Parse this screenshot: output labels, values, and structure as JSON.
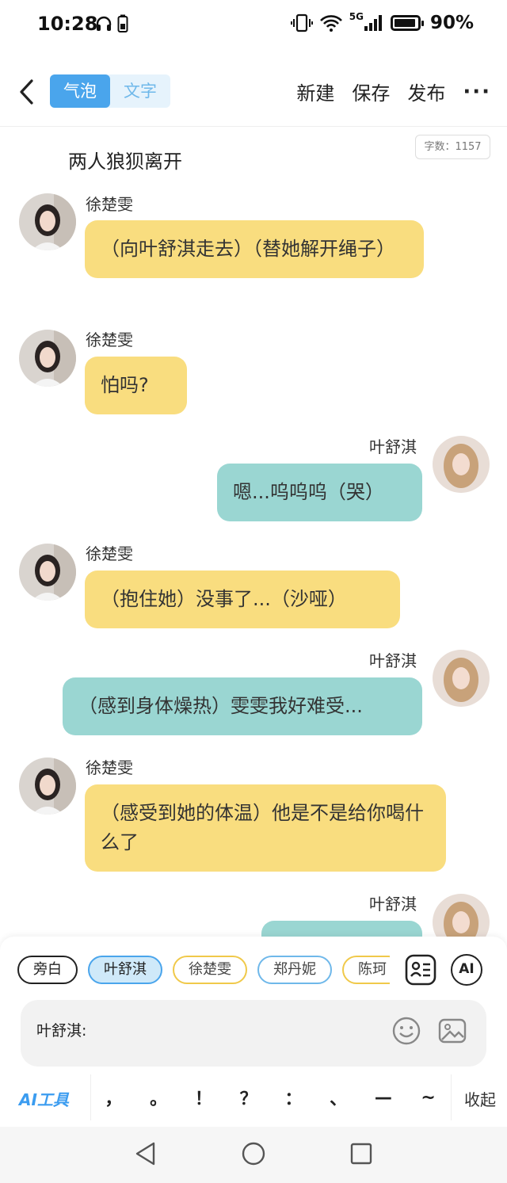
{
  "status_bar": {
    "time": "10:28",
    "network": "5G",
    "battery": "90%"
  },
  "toolbar": {
    "mode_tabs": [
      "气泡",
      "文字"
    ],
    "active_tab": "气泡",
    "new_label": "新建",
    "save_label": "保存",
    "publish_label": "发布",
    "more_label": "···"
  },
  "word_count": "字数：1157",
  "narration": "两人狼狈离开",
  "messages": [
    {
      "speaker": "徐楚雯",
      "side": "left",
      "text": "（向叶舒淇走去）（替她解开绳子）"
    },
    {
      "speaker": "徐楚雯",
      "side": "left",
      "text": "怕吗?"
    },
    {
      "speaker": "叶舒淇",
      "side": "right",
      "text": "嗯...呜呜呜（哭）"
    },
    {
      "speaker": "徐楚雯",
      "side": "left",
      "text": "（抱住她）没事了...（沙哑）"
    },
    {
      "speaker": "叶舒淇",
      "side": "right",
      "text": "（感到身体燥热）雯雯我好难受..."
    },
    {
      "speaker": "徐楚雯",
      "side": "left",
      "text": "（感受到她的体温）他是不是给你喝什么了"
    },
    {
      "speaker": "叶舒淇",
      "side": "right",
      "text": ""
    }
  ],
  "composer": {
    "roles": [
      "旁白",
      "叶舒淇",
      "徐楚雯",
      "郑丹妮",
      "陈珂"
    ],
    "selected_role": "叶舒淇",
    "input_prefix": "叶舒淇:",
    "ai_tool_label": "AI工具",
    "punctuation": [
      "，",
      "。",
      "！",
      "？",
      "：",
      "、",
      "—",
      "~"
    ],
    "collapse_label": "收起",
    "ai_button_label": "AI"
  },
  "colors": {
    "accent": "#4aa5ec",
    "left_bubble": "#f9dd7f",
    "right_bubble": "#9ad6d2"
  }
}
